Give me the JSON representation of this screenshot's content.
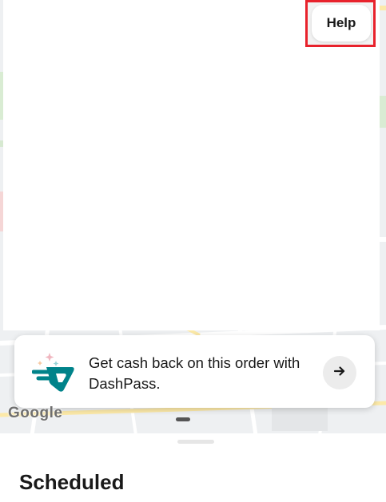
{
  "header": {
    "help_label": "Help"
  },
  "dashpass_banner": {
    "text": "Get cash back on this order with DashPass.",
    "logo_icon": "dashpass-logo-icon",
    "arrow_icon": "arrow-right-icon",
    "brand_color": "#00838A"
  },
  "map": {
    "attribution": "Google"
  },
  "sheet": {
    "title": "Scheduled"
  },
  "colors": {
    "highlight": "#E8222C",
    "text": "#191919"
  }
}
